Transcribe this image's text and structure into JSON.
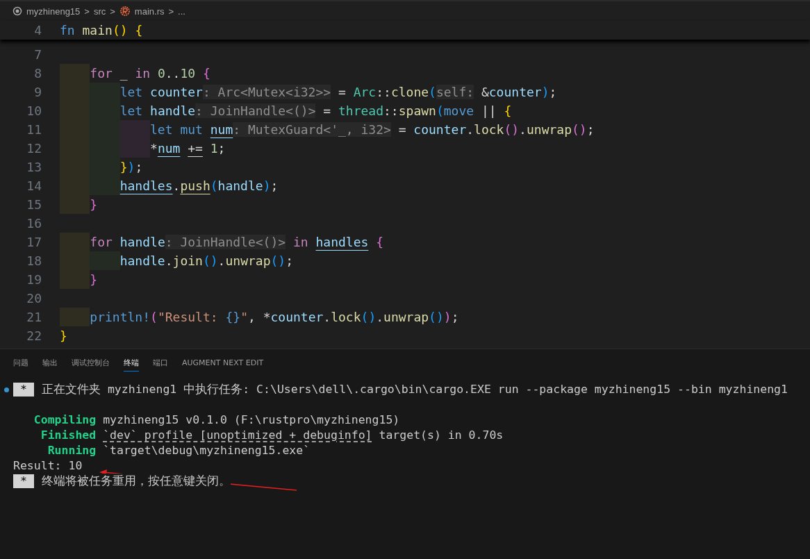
{
  "breadcrumb": [
    {
      "kind": "project",
      "text": "myzhineng15"
    },
    {
      "kind": "separator",
      "text": ">"
    },
    {
      "kind": "folder",
      "text": "src"
    },
    {
      "kind": "separator",
      "text": ">"
    },
    {
      "kind": "file",
      "text": "main.rs"
    },
    {
      "kind": "separator",
      "text": ">"
    },
    {
      "kind": "more",
      "text": "..."
    }
  ],
  "sticky_line": {
    "number": "4",
    "tokens": [
      {
        "text": "fn ",
        "kind": "kw"
      },
      {
        "text": "main",
        "kind": "fn"
      },
      {
        "text": "()",
        "kind": "b1"
      },
      {
        "text": " {",
        "kind": "b1"
      }
    ]
  },
  "lines": [
    {
      "number": "7"
    },
    {
      "number": "8",
      "tokens": [
        {
          "text": "    for",
          "kind": "ctrl"
        },
        {
          "text": " _ ",
          "kind": "p"
        },
        {
          "text": "in ",
          "kind": "ctrl"
        },
        {
          "text": "0",
          "kind": "num"
        },
        {
          "text": "..",
          "kind": "p"
        },
        {
          "text": "10",
          "kind": "num"
        },
        {
          "text": " {",
          "kind": "b2"
        }
      ]
    },
    {
      "number": "9",
      "tokens": [
        {
          "text": "        let ",
          "kind": "kw"
        },
        {
          "text": "counter",
          "kind": "var"
        },
        {
          "text": ": Arc<Mutex<i32>>",
          "kind": "hint"
        },
        {
          "text": " = ",
          "kind": "p"
        },
        {
          "text": "Arc",
          "kind": "type"
        },
        {
          "text": "::",
          "kind": "p"
        },
        {
          "text": "clone",
          "kind": "fn"
        },
        {
          "text": "(",
          "kind": "b3"
        },
        {
          "text": "self:",
          "kind": "hint"
        },
        {
          "text": " &",
          "kind": "p"
        },
        {
          "text": "counter",
          "kind": "var"
        },
        {
          "text": ")",
          "kind": "b3"
        },
        {
          "text": ";",
          "kind": "p"
        }
      ]
    },
    {
      "number": "10",
      "tokens": [
        {
          "text": "        let ",
          "kind": "kw"
        },
        {
          "text": "handle",
          "kind": "var"
        },
        {
          "text": ": JoinHandle<()>",
          "kind": "hint"
        },
        {
          "text": " = ",
          "kind": "p"
        },
        {
          "text": "thread",
          "kind": "type"
        },
        {
          "text": "::",
          "kind": "p"
        },
        {
          "text": "spawn",
          "kind": "fn"
        },
        {
          "text": "(",
          "kind": "b3"
        },
        {
          "text": "move ",
          "kind": "kw"
        },
        {
          "text": "|| ",
          "kind": "p"
        },
        {
          "text": "{",
          "kind": "b1"
        }
      ]
    },
    {
      "number": "11",
      "tokens": [
        {
          "text": "            let mut ",
          "kind": "kw"
        },
        {
          "text": "num",
          "kind": "var",
          "underlined": true
        },
        {
          "text": ": MutexGuard<'_, i32>",
          "kind": "hint"
        },
        {
          "text": " = ",
          "kind": "p"
        },
        {
          "text": "counter",
          "kind": "var"
        },
        {
          "text": ".",
          "kind": "p"
        },
        {
          "text": "lock",
          "kind": "fn"
        },
        {
          "text": "()",
          "kind": "b2"
        },
        {
          "text": ".",
          "kind": "p"
        },
        {
          "text": "unwrap",
          "kind": "fn"
        },
        {
          "text": "()",
          "kind": "b2"
        },
        {
          "text": ";",
          "kind": "p"
        }
      ]
    },
    {
      "number": "12",
      "tokens": [
        {
          "text": "            *",
          "kind": "p"
        },
        {
          "text": "num",
          "kind": "var",
          "underlined": true
        },
        {
          "text": " +=",
          "kind": "p",
          "underlined": true
        },
        {
          "text": " 1",
          "kind": "num"
        },
        {
          "text": ";",
          "kind": "p"
        }
      ]
    },
    {
      "number": "13",
      "tokens": [
        {
          "text": "        }",
          "kind": "b1"
        },
        {
          "text": ")",
          "kind": "b3"
        },
        {
          "text": ";",
          "kind": "p"
        }
      ]
    },
    {
      "number": "14",
      "tokens": [
        {
          "text": "        handles",
          "kind": "var",
          "underlined": true
        },
        {
          "text": ".",
          "kind": "p"
        },
        {
          "text": "push",
          "kind": "fn",
          "underlined": true
        },
        {
          "text": "(",
          "kind": "b3"
        },
        {
          "text": "handle",
          "kind": "var"
        },
        {
          "text": ")",
          "kind": "b3"
        },
        {
          "text": ";",
          "kind": "p"
        }
      ]
    },
    {
      "number": "15",
      "tokens": [
        {
          "text": "    }",
          "kind": "b2"
        }
      ]
    },
    {
      "number": "16"
    },
    {
      "number": "17",
      "tokens": [
        {
          "text": "    for ",
          "kind": "ctrl"
        },
        {
          "text": "handle",
          "kind": "var"
        },
        {
          "text": ": JoinHandle<()>",
          "kind": "hint"
        },
        {
          "text": " in ",
          "kind": "ctrl"
        },
        {
          "text": "handles",
          "kind": "var",
          "underlined": true
        },
        {
          "text": " {",
          "kind": "b2"
        }
      ]
    },
    {
      "number": "18",
      "tokens": [
        {
          "text": "        handle",
          "kind": "var"
        },
        {
          "text": ".",
          "kind": "p"
        },
        {
          "text": "join",
          "kind": "fn"
        },
        {
          "text": "()",
          "kind": "b3"
        },
        {
          "text": ".",
          "kind": "p"
        },
        {
          "text": "unwrap",
          "kind": "fn"
        },
        {
          "text": "()",
          "kind": "b3"
        },
        {
          "text": ";",
          "kind": "p"
        }
      ]
    },
    {
      "number": "19",
      "tokens": [
        {
          "text": "    }",
          "kind": "b2"
        }
      ]
    },
    {
      "number": "20"
    },
    {
      "number": "21",
      "tokens": [
        {
          "text": "    println!",
          "kind": "kw"
        },
        {
          "text": "(",
          "kind": "b2"
        },
        {
          "text": "\"Result: ",
          "kind": "str"
        },
        {
          "text": "{}",
          "kind": "kw"
        },
        {
          "text": "\"",
          "kind": "str"
        },
        {
          "text": ", *",
          "kind": "p"
        },
        {
          "text": "counter",
          "kind": "var"
        },
        {
          "text": ".",
          "kind": "p"
        },
        {
          "text": "lock",
          "kind": "fn"
        },
        {
          "text": "()",
          "kind": "b3"
        },
        {
          "text": ".",
          "kind": "p"
        },
        {
          "text": "unwrap",
          "kind": "fn"
        },
        {
          "text": "()",
          "kind": "b3"
        },
        {
          "text": ")",
          "kind": "b2"
        },
        {
          "text": ";",
          "kind": "p"
        }
      ]
    },
    {
      "number": "22",
      "tokens": [
        {
          "text": "}",
          "kind": "b1"
        }
      ]
    }
  ],
  "panel_tabs": [
    {
      "label": "问题",
      "selected": false
    },
    {
      "label": "输出",
      "selected": false
    },
    {
      "label": "调试控制台",
      "selected": false
    },
    {
      "label": "终端",
      "selected": true
    },
    {
      "label": "端口",
      "selected": false
    },
    {
      "label": "AUGMENT NEXT EDIT",
      "selected": false
    }
  ],
  "terminal": [
    {
      "kind": "task",
      "decorated": true,
      "badge": "*",
      "text": "正在文件夹 myzhineng1 中执行任务: C:\\Users\\dell\\.cargo\\bin\\cargo.EXE run --package myzhineng15 --bin myzhineng1"
    },
    {
      "kind": "blank"
    },
    {
      "kind": "cargo",
      "label": "Compiling",
      "segments": [
        {
          "text": "myzhineng15 v0.1.0 (F:\\rustpro\\myzhineng15)",
          "underlined": false
        }
      ]
    },
    {
      "kind": "cargo",
      "label": "Finished",
      "segments": [
        {
          "text": "`dev` profile [unoptimized + debuginfo]",
          "underlined": true
        },
        {
          "text": " target(s) in 0.70s",
          "underlined": false
        }
      ]
    },
    {
      "kind": "cargo",
      "label": "Running",
      "segments": [
        {
          "text": "`target\\debug\\myzhineng15.exe`",
          "underlined": false
        }
      ]
    },
    {
      "kind": "plain",
      "text": "Result: 10"
    },
    {
      "kind": "task",
      "decorated": false,
      "badge": "*",
      "text": "终端将被任务重用，按任意键关闭。"
    }
  ]
}
